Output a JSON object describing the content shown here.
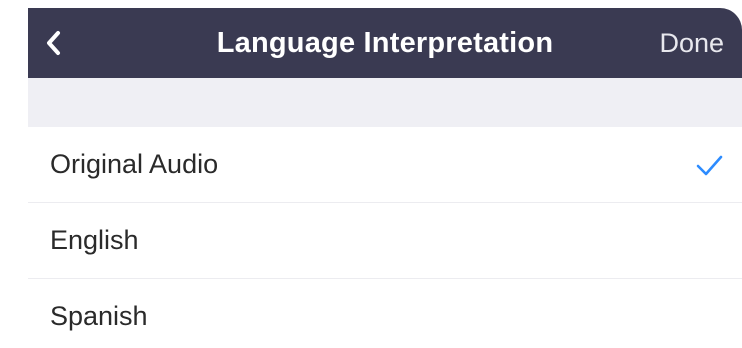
{
  "header": {
    "back_icon": "chevron-left-icon",
    "title": "Language Interpretation",
    "done_label": "Done",
    "background_color": "#3a3a52"
  },
  "languages": [
    {
      "label": "Original Audio",
      "selected": true
    },
    {
      "label": "English",
      "selected": false
    },
    {
      "label": "Spanish",
      "selected": false
    }
  ],
  "accent_color": "#2d8cff",
  "check_icon": "checkmark-icon"
}
